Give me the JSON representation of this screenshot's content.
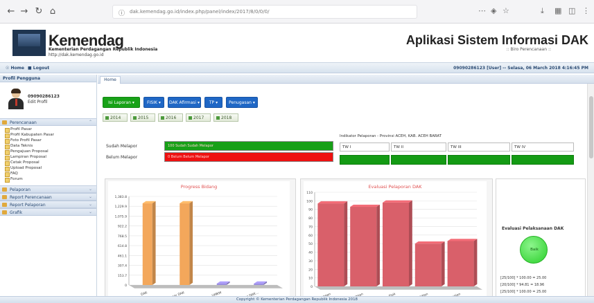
{
  "browser": {
    "url": "dak.kemendag.go.id/index.php/panel/index/2017/8/0/0/0/",
    "back_icon": "arrow-left",
    "forward_icon": "arrow-right",
    "reload_icon": "reload",
    "home_icon": "home"
  },
  "header": {
    "brand": "Kemendag",
    "brand_sub": "Kementerian Perdagangan Republik Indonesia",
    "brand_url": "http://dak.kemendag.go.id",
    "app_title": "Aplikasi Sistem Informasi DAK",
    "app_subtitle": ":: Biro Perencanaan ::"
  },
  "navbar": {
    "home": "Home",
    "logout": "Logout",
    "user_info": "09090286123 [User] -- Selasa, 06 March 2018 4:16:45 PM"
  },
  "sidebar": {
    "profile_title": "Profil Pengguna",
    "user_id": "09090286123",
    "edit_profile": "Edit Profil",
    "sections": [
      {
        "label": "Perencanaan"
      },
      {
        "label": "Pelaporan"
      },
      {
        "label": "Report Perencanaan"
      },
      {
        "label": "Report Pelaporan"
      },
      {
        "label": "Grafik"
      }
    ],
    "items": [
      "Profil Pasar",
      "Profil Kabupaten Pasar",
      "Foto Profil Pasar",
      "Data Teknis",
      "Pengajuan Proposal",
      "Lampiran Proposal",
      "Cetak Proposal",
      "Upload Proposal",
      "FAQ",
      "Forum"
    ]
  },
  "main": {
    "tab": "Home",
    "buttons": [
      {
        "label": "Isi Laporan ▾",
        "color": "#18a218"
      },
      {
        "label": "FISIK ▾",
        "color": "#1f67c5"
      },
      {
        "label": "DAK Afirmasi ▾",
        "color": "#1f67c5"
      },
      {
        "label": "TP ▾",
        "color": "#1f67c5"
      },
      {
        "label": "Penugasan ▾",
        "color": "#1f67c5"
      }
    ],
    "years": [
      "2014",
      "2015",
      "2016",
      "2017",
      "2018"
    ],
    "status": {
      "sudah_label": "Sudah Melapor",
      "belum_label": "Belum Melapor",
      "sudah_text": "100 Sudah Sudah Melapor",
      "belum_text": "0 Belum Belum Melapor",
      "sudah_color": "#17a017",
      "belum_color": "#ee1111",
      "sudah_fraction": 1.0,
      "belum_fraction": 1.0
    },
    "indicator": {
      "title": "Indikator Pelaporan - Provinsi ACEH, KAB. ACEH BARAT",
      "columns": [
        "TW I",
        "TW II",
        "TW III",
        "TW IV"
      ]
    },
    "evaluation": {
      "title": "Evaluasi Pelaksanaan DAK",
      "badge": "Baik",
      "lines": [
        "[25/100] * 100.00 = 25.00",
        "[20/100] * 94.81 = 18.96",
        "[25/100] * 100.00 = 25.00"
      ]
    }
  },
  "chart_data": [
    {
      "type": "bar",
      "title": "Progress Bidang",
      "categories": [
        "DAK",
        "Pasar DAK",
        "UMKM",
        "Pasar DAK..."
      ],
      "ylim": [
        0,
        1500
      ],
      "yticks": [
        "1,383.8",
        "1,229.9",
        "1,075.9",
        "922.2",
        "768.5",
        "614.8",
        "461.1",
        "307.4",
        "153.7",
        "0"
      ],
      "values": [
        1383.8,
        1383.8,
        0,
        0
      ],
      "color": "#f3a75b"
    },
    {
      "type": "bar",
      "title": "Evaluasi Pelaporan DAK",
      "categories": [
        "Perencanaan",
        "Penyerapan",
        "Fisik",
        "Ketepatan",
        "Kesesuaian"
      ],
      "ylim": [
        0,
        110
      ],
      "yticks": [
        "110",
        "100",
        "90",
        "80",
        "70",
        "60",
        "50",
        "40",
        "30",
        "20",
        "10",
        "0"
      ],
      "values": [
        97,
        93,
        98,
        50,
        53
      ],
      "color": "#d9606a"
    }
  ],
  "footer": "Copyright © Kementerian Perdagangan Republik Indonesia 2018"
}
